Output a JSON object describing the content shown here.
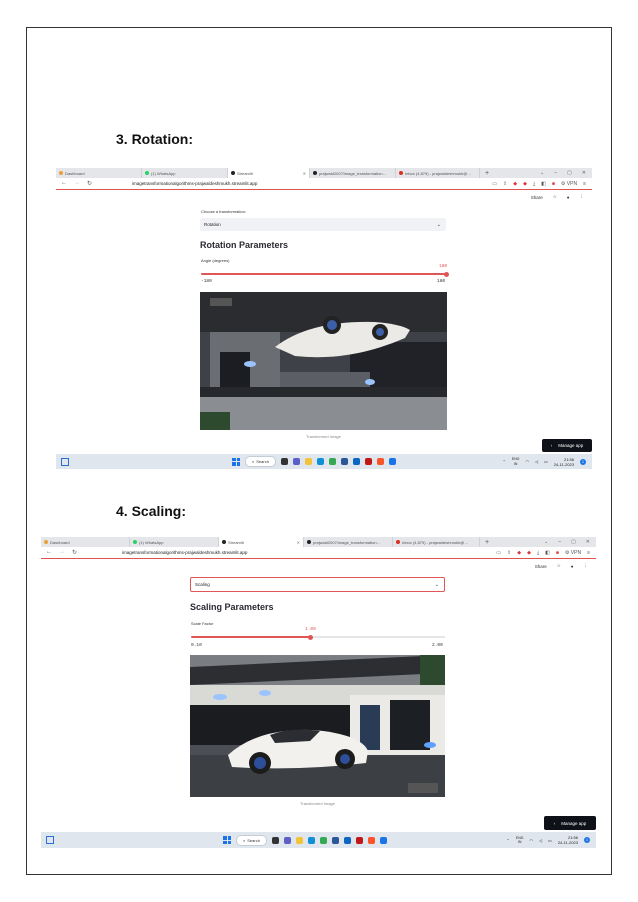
{
  "sections": [
    {
      "heading": "3.  Rotation:",
      "browser": {
        "tabs": [
          {
            "label": "Dashboard",
            "color": "#e8a23a"
          },
          {
            "label": "(1) WhatsApp",
            "color": "#25d366"
          },
          {
            "label": "Streamlit",
            "color": "#222222"
          },
          {
            "label": "prajwald2007/image_transformation…",
            "color": "#222222"
          },
          {
            "label": "Inbox (4,879) - prajwaldeshmukh@…",
            "color": "#d93025"
          }
        ],
        "url": "imagetransformationalgorithms-prajwaldeshmukh.streamlit.app",
        "share": "Share"
      },
      "app": {
        "select_label": "Choose a transformation:",
        "select_value": "Rotation",
        "params_title": "Rotation Parameters",
        "slider_label": "Angle (degrees)",
        "slider_value": "180",
        "slider_fraction": 1.0,
        "slider_min": "-180",
        "slider_max": "180",
        "caption": "Transformed Image"
      },
      "manage_label": "Manage app"
    },
    {
      "heading": "4.  Scaling:",
      "browser": {
        "tabs": [
          {
            "label": "Dashboard",
            "color": "#e8a23a"
          },
          {
            "label": "(1) WhatsApp",
            "color": "#25d366"
          },
          {
            "label": "Streamlit",
            "color": "#222222"
          },
          {
            "label": "prajwald2007/image_transformation…",
            "color": "#222222"
          },
          {
            "label": "Inbox (4,879) - prajwaldeshmukh@…",
            "color": "#d93025"
          }
        ],
        "url": "imagetransformationalgorithms-prajwaldeshmukh.streamlit.app",
        "share": "Share"
      },
      "app": {
        "select_value": "Scaling",
        "params_title": "Scaling Parameters",
        "slider_label": "Scale Factor",
        "slider_value": "1.00",
        "slider_fraction": 0.47,
        "slider_min": "0.10",
        "slider_max": "2.00",
        "caption": "Transformed Image"
      },
      "manage_label": "Manage app"
    }
  ],
  "taskbar": {
    "search": "Search",
    "lang_top": "ENG",
    "lang_bottom": "IN",
    "time": "21:56",
    "date": "24-11-2023",
    "notif": "1"
  },
  "colors": {
    "accent": "#e05656",
    "taskbar": "#dfe6ee",
    "manage_bg": "#0e1117"
  }
}
